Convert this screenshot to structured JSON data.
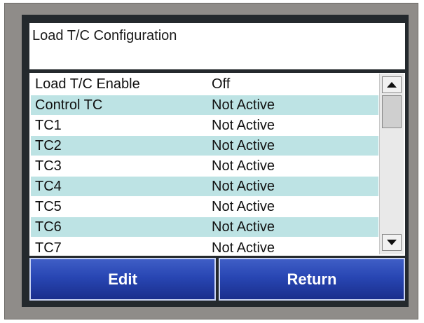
{
  "title": "Load T/C Configuration",
  "rows": [
    {
      "name": "Load T/C Enable",
      "value": "Off"
    },
    {
      "name": "Control TC",
      "value": "Not Active"
    },
    {
      "name": "TC1",
      "value": "Not Active"
    },
    {
      "name": "TC2",
      "value": "Not Active"
    },
    {
      "name": "TC3",
      "value": "Not Active"
    },
    {
      "name": "TC4",
      "value": "Not Active"
    },
    {
      "name": "TC5",
      "value": "Not Active"
    },
    {
      "name": "TC6",
      "value": "Not Active"
    },
    {
      "name": "TC7",
      "value": "Not Active"
    }
  ],
  "buttons": {
    "edit": "Edit",
    "return": "Return"
  },
  "colors": {
    "alt_row": "#bde3e4",
    "button_blue": "#2846b3",
    "bezel": "#8f8c89"
  },
  "icons": {
    "scroll_up": "triangle-up-icon",
    "scroll_down": "triangle-down-icon"
  }
}
